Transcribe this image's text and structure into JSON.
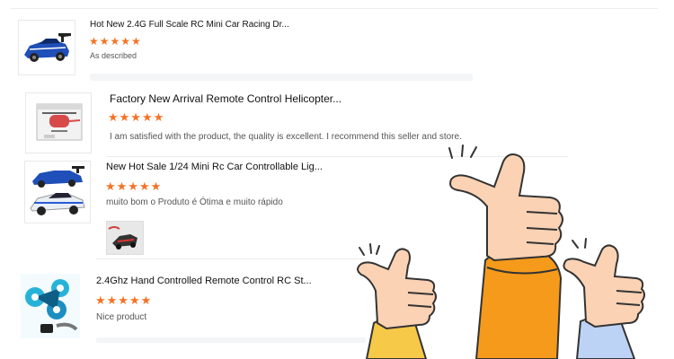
{
  "reviews": [
    {
      "title": "Hot New 2.4G Full Scale RC Mini Car Racing Dr...",
      "stars": "★★★★★",
      "comment": "As described",
      "image_icon": "rc-car-blue-icon"
    },
    {
      "title": "Factory New Arrival Remote Control Helicopter...",
      "stars": "★★★★★",
      "comment": "I am satisfied with the product, the quality is excellent. I recommend this seller and store.",
      "image_icon": "helicopter-box-icon"
    },
    {
      "title": "New Hot Sale 1/24 Mini Rc Car Controllable Lig...",
      "stars": "★★★★★",
      "comment": "muito bom o Produto é Ótima e muito rápido",
      "image_icon": "rc-cars-pair-icon",
      "review_photo_icon": "review-photo-icon"
    },
    {
      "title": "2.4Ghz Hand Controlled Remote Control RC St...",
      "stars": "★★★★★",
      "comment": "Nice product",
      "image_icon": "stunt-car-icon"
    }
  ],
  "colors": {
    "star": "#f57224",
    "sleeve_orange": "#f59a1b",
    "sleeve_yellow": "#f7c948",
    "sleeve_blue": "#bcd3f5",
    "skin": "#fbd2b4"
  },
  "illustration_icon": "thumbs-up-hands-icon"
}
